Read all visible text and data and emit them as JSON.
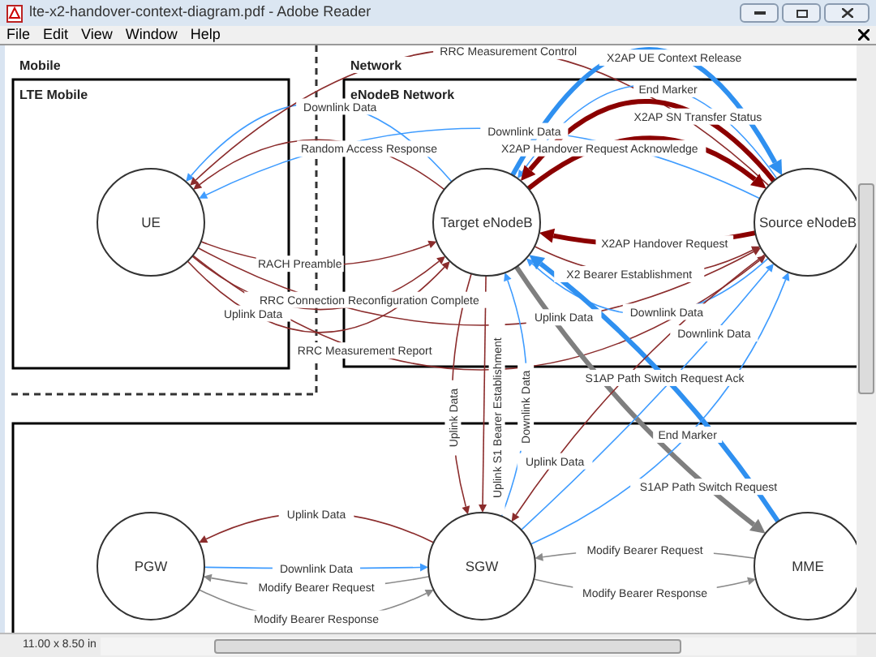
{
  "window": {
    "title": "lte-x2-handover-context-diagram.pdf - Adobe Reader"
  },
  "menu": [
    "File",
    "Edit",
    "View",
    "Window",
    "Help"
  ],
  "diagram": {
    "groups": [
      {
        "label": "Mobile"
      },
      {
        "label": "Network"
      }
    ],
    "lanes": [
      {
        "label": "LTE Mobile"
      },
      {
        "label": "eNodeB Network"
      }
    ],
    "nodes": [
      {
        "label": "UE"
      },
      {
        "label": "Target eNodeB"
      },
      {
        "label": "Source eNodeB"
      },
      {
        "label": "PGW"
      },
      {
        "label": "SGW"
      },
      {
        "label": "MME"
      }
    ],
    "edges": [
      {
        "label": "Downlink Data",
        "kind": "data"
      },
      {
        "label": "Random Access Response",
        "kind": "signal"
      },
      {
        "label": "RRC Measurement Control",
        "kind": "signal"
      },
      {
        "label": "Downlink Data",
        "kind": "data"
      },
      {
        "label": "RACH Preamble",
        "kind": "signal"
      },
      {
        "label": "RRC Connection Reconfiguration Complete",
        "kind": "signal"
      },
      {
        "label": "Uplink Data",
        "kind": "signal"
      },
      {
        "label": "Uplink Data",
        "kind": "signal"
      },
      {
        "label": "RRC Measurement Report",
        "kind": "signal"
      },
      {
        "label": "X2AP UE Context Release",
        "kind": "strong-data"
      },
      {
        "label": "End Marker",
        "kind": "data"
      },
      {
        "label": "X2AP SN Transfer Status",
        "kind": "strong-signal"
      },
      {
        "label": "X2AP Handover Request Acknowledge",
        "kind": "strong-signal"
      },
      {
        "label": "X2AP Handover Request",
        "kind": "strong-signal"
      },
      {
        "label": "X2 Bearer Establishment",
        "kind": "signal"
      },
      {
        "label": "Downlink Data",
        "kind": "data"
      },
      {
        "label": "Uplink Data",
        "kind": "signal"
      },
      {
        "label": "Uplink S1 Bearer Establishment",
        "kind": "signal"
      },
      {
        "label": "Downlink Data",
        "kind": "data"
      },
      {
        "label": "S1AP Path Switch Request Ack",
        "kind": "strong-data"
      },
      {
        "label": "S1AP Path Switch Request",
        "kind": "strong-path"
      },
      {
        "label": "Uplink Data",
        "kind": "signal"
      },
      {
        "label": "Downlink Data",
        "kind": "data"
      },
      {
        "label": "End Marker",
        "kind": "data"
      },
      {
        "label": "Uplink Data",
        "kind": "signal"
      },
      {
        "label": "Downlink Data",
        "kind": "data"
      },
      {
        "label": "Modify Bearer Request",
        "kind": "bearer"
      },
      {
        "label": "Modify Bearer Response",
        "kind": "bearer"
      },
      {
        "label": "Modify Bearer Request",
        "kind": "bearer"
      },
      {
        "label": "Modify Bearer Response",
        "kind": "bearer"
      }
    ]
  },
  "status_bar": {
    "page_size": "11.00 x 8.50 in"
  }
}
